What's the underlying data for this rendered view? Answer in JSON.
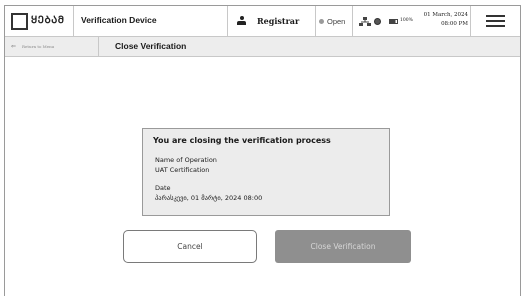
{
  "header": {
    "logo_text": "ᲧᲔᲑᲐᲛ",
    "logo_subtitle": "",
    "device_title": "Verification Device",
    "user_label": "Registrar",
    "status_label": "Open",
    "battery_label": "100%",
    "date_label": "01 March, 2024",
    "time_label": "08:00 PM",
    "icons": [
      "person-icon",
      "network-icon",
      "gear-icon",
      "battery-icon",
      "hamburger-menu-icon"
    ]
  },
  "subbar": {
    "back_label": "Return to Menu",
    "page_title": "Close Verification"
  },
  "dialog": {
    "title": "You are closing the verification process",
    "operation_label": "Name of Operation",
    "operation_value": "UAT Certification",
    "date_label": "Date",
    "date_value": "პარასკევი, 01 მარტი, 2024 08:00"
  },
  "actions": {
    "cancel_label": "Cancel",
    "confirm_label": "Close Verification"
  },
  "colors": {
    "confirm_button": "#8f8f8f",
    "card_background": "#ececec",
    "subbar_background": "#ededed",
    "status_dot": "#9a9a9a"
  }
}
